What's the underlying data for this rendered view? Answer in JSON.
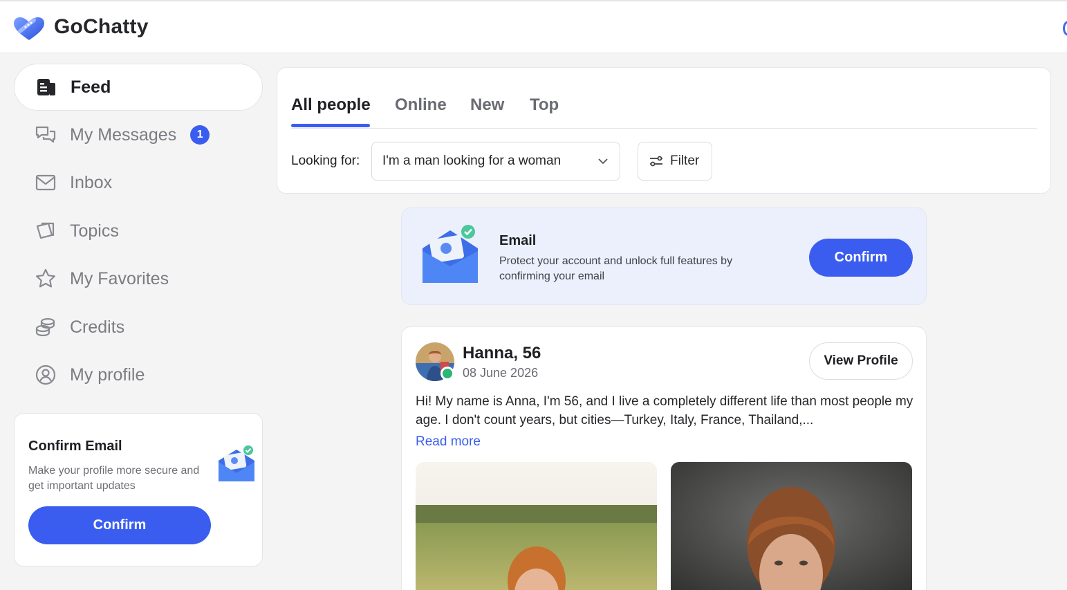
{
  "app": {
    "name": "GoChatty"
  },
  "sidebar": {
    "items": [
      {
        "label": "Feed",
        "icon": "feed-icon",
        "active": true
      },
      {
        "label": "My Messages",
        "icon": "messages-icon",
        "badge": "1"
      },
      {
        "label": "Inbox",
        "icon": "inbox-icon"
      },
      {
        "label": "Topics",
        "icon": "topics-icon"
      },
      {
        "label": "My Favorites",
        "icon": "star-icon"
      },
      {
        "label": "Credits",
        "icon": "coins-icon"
      },
      {
        "label": "My profile",
        "icon": "profile-icon"
      }
    ],
    "confirm_card": {
      "title": "Confirm Email",
      "description": "Make your profile more secure and get important updates",
      "button": "Confirm"
    }
  },
  "tabs": [
    {
      "label": "All people",
      "active": true
    },
    {
      "label": "Online"
    },
    {
      "label": "New"
    },
    {
      "label": "Top"
    }
  ],
  "filters": {
    "looking_for_label": "Looking for:",
    "looking_for_value": "I'm a man looking for a woman",
    "filter_button": "Filter"
  },
  "email_banner": {
    "title": "Email",
    "description": "Protect your account and unlock full features by confirming your email",
    "button": "Confirm"
  },
  "post": {
    "name": "Hanna, 56",
    "date": "08 June 2026",
    "text": "Hi! My name is Anna, I'm 56, and I live a completely different life than most people my age. I don't count years, but cities—Turkey, Italy, France, Thailand,...",
    "read_more": "Read more",
    "view_profile": "View Profile",
    "online": true
  },
  "colors": {
    "accent": "#3a5df0",
    "online": "#2bb673",
    "banner_bg": "#ebf0fc"
  }
}
